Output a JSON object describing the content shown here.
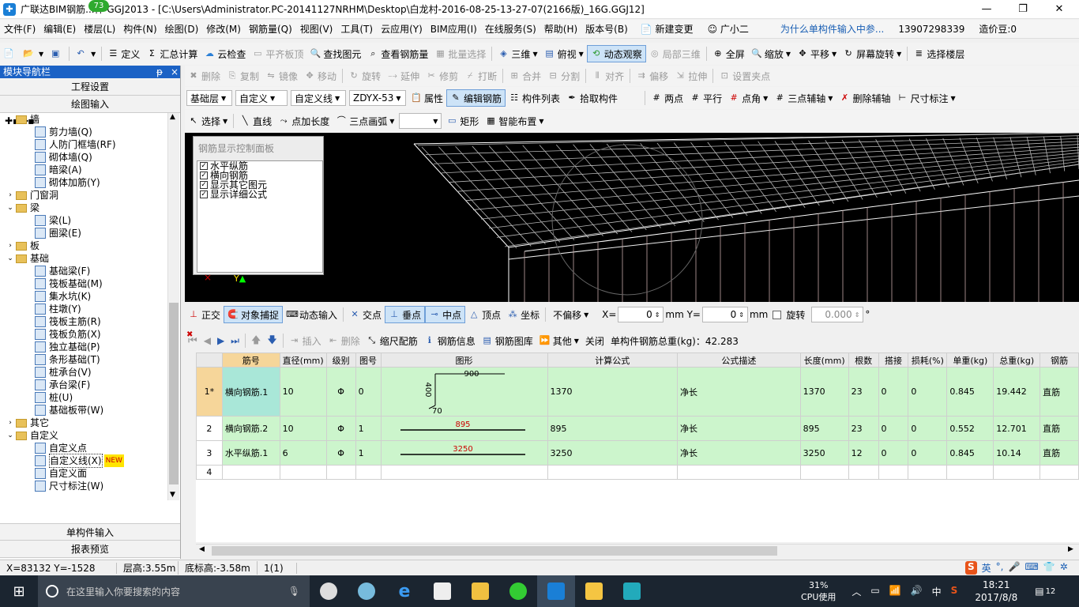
{
  "title": {
    "text": "广联达BIM钢筋...件 GGJ2013 - [C:\\Users\\Administrator.PC-20141127NRHM\\Desktop\\白龙村-2016-08-25-13-27-07(2166版)_16G.GGJ12]",
    "badge": "73"
  },
  "menu": [
    "文件(F)",
    "编辑(E)",
    "楼层(L)",
    "构件(N)",
    "绘图(D)",
    "修改(M)",
    "钢筋量(Q)",
    "视图(V)",
    "工具(T)",
    "云应用(Y)",
    "BIM应用(I)",
    "在线服务(S)",
    "帮助(H)",
    "版本号(B)"
  ],
  "menu_right": {
    "new_change": "新建变更",
    "guangxiao": "广小二",
    "question": "为什么单构件输入中参...",
    "phone": "13907298339",
    "price": "造价豆:0"
  },
  "toolbar1": {
    "define": "定义",
    "sum": "汇总计算",
    "cloud_check": "云检查",
    "flush": "平齐板顶",
    "find": "查找图元",
    "view_rebar": "查看钢筋量",
    "batch": "批量选择",
    "three_d": "三维",
    "top_view": "俯视",
    "dynamic": "动态观察",
    "local_3d": "局部三维",
    "fullscreen": "全屏",
    "zoom": "缩放",
    "pan": "平移",
    "screen_rotate": "屏幕旋转",
    "select_floor": "选择楼层"
  },
  "toolbar2": [
    "删除",
    "复制",
    "镜像",
    "移动",
    "旋转",
    "延伸",
    "修剪",
    "打断",
    "合并",
    "分割",
    "对齐",
    "偏移",
    "拉伸",
    "设置夹点"
  ],
  "toolbar3": {
    "layer": "基础层",
    "type1": "自定义",
    "type2": "自定义线",
    "code": "ZDYX-53",
    "attr": "属性",
    "edit_rebar": "编辑钢筋",
    "list": "构件列表",
    "pick": "拾取构件",
    "two_pts": "两点",
    "parallel": "平行",
    "pt_angle": "点角",
    "three_axis": "三点辅轴",
    "del_axis": "删除辅轴",
    "dim": "尺寸标注"
  },
  "toolbar4": {
    "select": "选择",
    "line": "直线",
    "add_len": "点加长度",
    "arc": "三点画弧",
    "rect": "矩形",
    "smart": "智能布置"
  },
  "nav": {
    "header": "模块导航栏",
    "pin": "ᵽ",
    "close": "×",
    "btn_proj": "工程设置",
    "btn_draw": "绘图输入",
    "tree": [
      {
        "t": "f",
        "label": "墙",
        "open": true
      },
      {
        "t": "l",
        "label": "剪力墙(Q)"
      },
      {
        "t": "l",
        "label": "人防门框墙(RF)"
      },
      {
        "t": "l",
        "label": "砌体墙(Q)"
      },
      {
        "t": "l",
        "label": "暗梁(A)"
      },
      {
        "t": "l",
        "label": "砌体加筋(Y)"
      },
      {
        "t": "f",
        "label": "门窗洞",
        "open": false
      },
      {
        "t": "f",
        "label": "梁",
        "open": true
      },
      {
        "t": "l",
        "label": "梁(L)"
      },
      {
        "t": "l",
        "label": "圈梁(E)"
      },
      {
        "t": "f",
        "label": "板",
        "open": false
      },
      {
        "t": "f",
        "label": "基础",
        "open": true
      },
      {
        "t": "l",
        "label": "基础梁(F)"
      },
      {
        "t": "l",
        "label": "筏板基础(M)"
      },
      {
        "t": "l",
        "label": "集水坑(K)"
      },
      {
        "t": "l",
        "label": "柱墩(Y)"
      },
      {
        "t": "l",
        "label": "筏板主筋(R)"
      },
      {
        "t": "l",
        "label": "筏板负筋(X)"
      },
      {
        "t": "l",
        "label": "独立基础(P)"
      },
      {
        "t": "l",
        "label": "条形基础(T)"
      },
      {
        "t": "l",
        "label": "桩承台(V)"
      },
      {
        "t": "l",
        "label": "承台梁(F)"
      },
      {
        "t": "l",
        "label": "桩(U)"
      },
      {
        "t": "l",
        "label": "基础板带(W)"
      },
      {
        "t": "f",
        "label": "其它",
        "open": false
      },
      {
        "t": "f",
        "label": "自定义",
        "open": true
      },
      {
        "t": "l",
        "label": "自定义点"
      },
      {
        "t": "l",
        "label": "自定义线(X)",
        "new": "NEW",
        "selected": true
      },
      {
        "t": "l",
        "label": "自定义面"
      },
      {
        "t": "l",
        "label": "尺寸标注(W)"
      }
    ],
    "btn_single": "单构件输入",
    "btn_report": "报表预览"
  },
  "panel": {
    "title": "钢筋显示控制面板",
    "items": [
      "水平纵筋",
      "横向钢筋",
      "显示其它图元",
      "显示详细公式"
    ]
  },
  "snapbar": {
    "ortho": "正交",
    "snap": "对象捕捉",
    "dyn": "动态输入",
    "intersect": "交点",
    "perp": "垂点",
    "mid": "中点",
    "vertex": "顶点",
    "coord": "坐标",
    "offset": "不偏移",
    "x_label": "X=",
    "x_val": "0",
    "y_label": "mm Y=",
    "y_val": "0",
    "mm": "mm",
    "rotate": "旋转",
    "rot_val": "0.000",
    "deg": "°"
  },
  "gridbar": {
    "insert": "插入",
    "delete": "删除",
    "scale": "缩尺配筋",
    "info": "钢筋信息",
    "lib": "钢筋图库",
    "other": "其他",
    "close": "关闭",
    "total": "单构件钢筋总重(kg)：42.283"
  },
  "table": {
    "headers": [
      "",
      "筋号",
      "直径(mm)",
      "级别",
      "图号",
      "图形",
      "计算公式",
      "公式描述",
      "长度(mm)",
      "根数",
      "搭接",
      "损耗(%)",
      "单重(kg)",
      "总重(kg)",
      "钢筋"
    ],
    "rows": [
      {
        "idx": "1*",
        "name": "横向钢筋.1",
        "dia": "10",
        "grade": "Φ",
        "fig": "0",
        "shape": {
          "a": "900",
          "b": "400",
          "c": "70"
        },
        "formula": "1370",
        "desc": "净长",
        "len": "1370",
        "count": "23",
        "lap": "0",
        "loss": "0",
        "unit": "0.845",
        "total": "19.442",
        "kind": "直筋"
      },
      {
        "idx": "2",
        "name": "横向钢筋.2",
        "dia": "10",
        "grade": "Φ",
        "fig": "1",
        "shape": {
          "a": "895"
        },
        "formula": "895",
        "desc": "净长",
        "len": "895",
        "count": "23",
        "lap": "0",
        "loss": "0",
        "unit": "0.552",
        "total": "12.701",
        "kind": "直筋"
      },
      {
        "idx": "3",
        "name": "水平纵筋.1",
        "dia": "6",
        "grade": "Φ",
        "fig": "1",
        "shape": {
          "a": "3250"
        },
        "formula": "3250",
        "desc": "净长",
        "len": "3250",
        "count": "12",
        "lap": "0",
        "loss": "0",
        "unit": "0.845",
        "total": "10.14",
        "kind": "直筋"
      },
      {
        "idx": "4",
        "name": "",
        "dia": "",
        "grade": "",
        "fig": "",
        "shape": {},
        "formula": "",
        "desc": "",
        "len": "",
        "count": "",
        "lap": "",
        "loss": "",
        "unit": "",
        "total": "",
        "kind": ""
      }
    ]
  },
  "status": {
    "coord": "X=83132 Y=-1528",
    "floor_h": "层高:3.55m",
    "bottom_h": "底标高:-3.58m",
    "sel": "1(1)"
  },
  "taskbar": {
    "search": "在这里输入你要搜索的内容",
    "cpu_pct": "31%",
    "cpu_label": "CPU使用",
    "lang": "中",
    "ime": "英",
    "time": "18:21",
    "date": "2017/8/8",
    "notif": "12"
  }
}
